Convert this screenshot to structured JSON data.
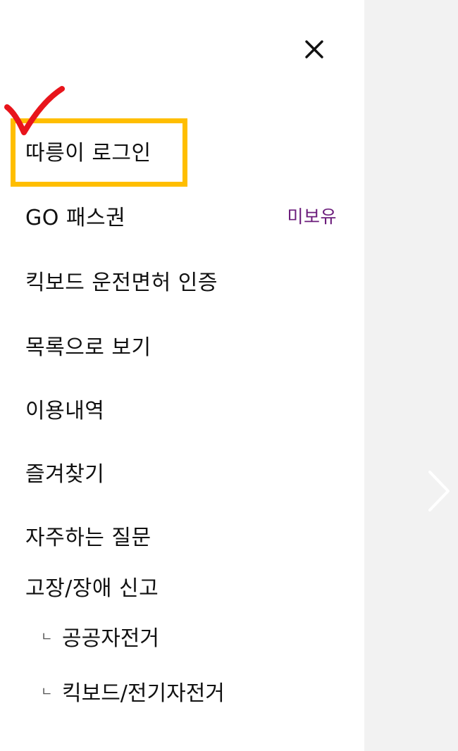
{
  "menu": {
    "close_label": "×",
    "items": [
      {
        "label": "따릉이 로그인"
      },
      {
        "label": "GO 패스권",
        "badge": "미보유"
      },
      {
        "label": "킥보드 운전면허 인증"
      },
      {
        "label": "목록으로 보기"
      },
      {
        "label": "이용내역"
      },
      {
        "label": "즐겨찾기"
      },
      {
        "label": "자주하는 질문"
      },
      {
        "label": "고장/장애 신고"
      }
    ],
    "sub_items": [
      {
        "prefix": "ㄴ",
        "label": "공공자전거"
      },
      {
        "prefix": "ㄴ",
        "label": "킥보드/전기자전거"
      }
    ]
  },
  "colors": {
    "badge": "#6b1c7b",
    "highlight": "#ffbe00",
    "checkmark": "#e8141b",
    "overlay": "#f2f2f2"
  }
}
